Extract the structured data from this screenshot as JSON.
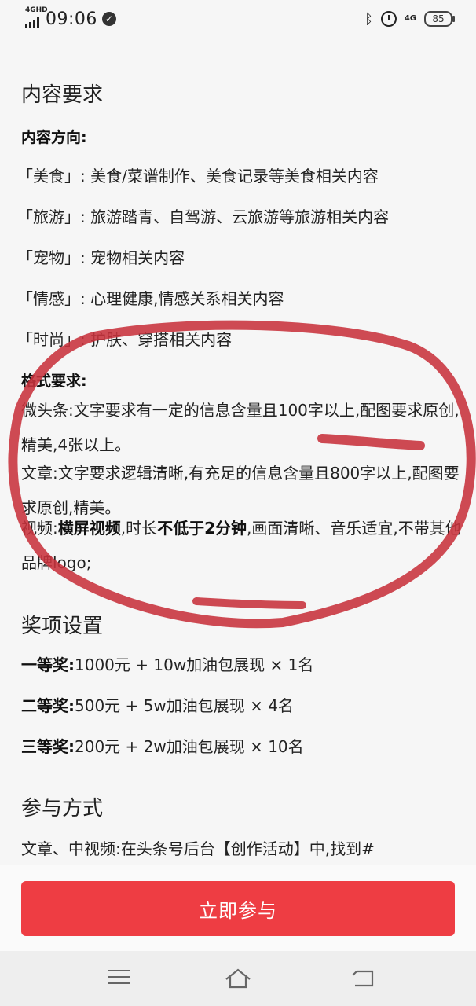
{
  "status_bar": {
    "network": "4GHD",
    "time": "09:06",
    "right_network": "4G",
    "battery": "85"
  },
  "content": {
    "section1_title": "内容要求",
    "direction_title": "内容方向:",
    "directions": [
      "「美食」:  美食/菜谱制作、美食记录等美食相关内容",
      "「旅游」:  旅游踏青、自驾游、云旅游等旅游相关内容",
      "「宠物」:  宠物相关内容",
      "「情感」:  心理健康,情感关系相关内容",
      "「时尚」:  护肤、穿搭相关内容"
    ],
    "format_title": "格式要求:",
    "weitoutiao": "微头条:文字要求有一定的信息含量且100字以上,配图要求原创,精美,4张以上。",
    "article": "文章:文字要求逻辑清晰,有充足的信息含量且800字以上,配图要求原创,精美。",
    "video": {
      "prefix": "视频:",
      "bold1": "横屏视频",
      "mid": ",时长",
      "bold2": "不低于2分钟",
      "suffix": ",画面清晰、音乐适宜,不带其他品牌logo;"
    },
    "section2_title": "奖项设置",
    "prizes": [
      {
        "label": "一等奖:",
        "text": "1000元 + 10w加油包展现 × 1名"
      },
      {
        "label": "二等奖:",
        "text": "500元 + 5w加油包展现 × 4名"
      },
      {
        "label": "三等奖:",
        "text": "200元 + 2w加油包展现 × 10名"
      }
    ],
    "section3_title": "参与方式",
    "participate": "文章、中视频:在头条号后台【创作活动】中,找到#"
  },
  "bottom": {
    "join_label": "立即参与"
  },
  "colors": {
    "accent": "#ee3d43",
    "annotation": "#c8323c"
  },
  "icons": [
    "menu-icon",
    "home-icon",
    "back-icon"
  ]
}
